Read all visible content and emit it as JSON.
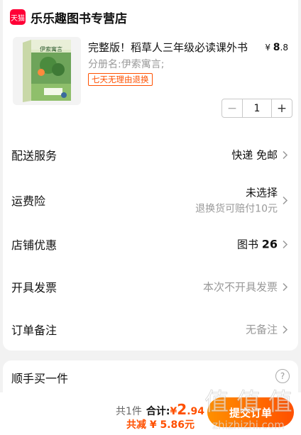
{
  "shop": {
    "badge": "天猫",
    "name": "乐乐趣图书专营店"
  },
  "product": {
    "title": "完整版！稻草人三年级必读课外书",
    "price_symbol": "¥",
    "price_int": "8",
    "price_dec": ".8",
    "sku": "分册名:伊索寓言;",
    "tag": "七天无理由退换",
    "quantity": "1",
    "minus": "−",
    "plus": "+",
    "cover_title": "伊索寓言"
  },
  "rows": {
    "delivery": {
      "label": "配送服务",
      "value": "快递 免邮"
    },
    "insurance": {
      "label": "运费险",
      "value": "未选择",
      "sub": "退换货可赔付10元"
    },
    "discount": {
      "label": "店铺优惠",
      "value_prefix": "图书",
      "value_num": "26"
    },
    "invoice": {
      "label": "开具发票",
      "value": "本次不开具发票"
    },
    "remark": {
      "label": "订单备注",
      "value": "无备注"
    }
  },
  "extra": {
    "title": "顺手买一件",
    "help": "?"
  },
  "footer": {
    "count": "共1件",
    "total_label": "合计:",
    "total_symbol": "¥",
    "total_int": "2",
    "total_dec": ".94",
    "reduce": "共减 ¥ 5.86元",
    "submit": "提交订单"
  },
  "watermark": {
    "text": "值 值 值",
    "site": "zhizhizhi.com"
  },
  "colors": {
    "accent": "#ff5000",
    "tmall": "#ff0036",
    "muted": "#999999"
  }
}
